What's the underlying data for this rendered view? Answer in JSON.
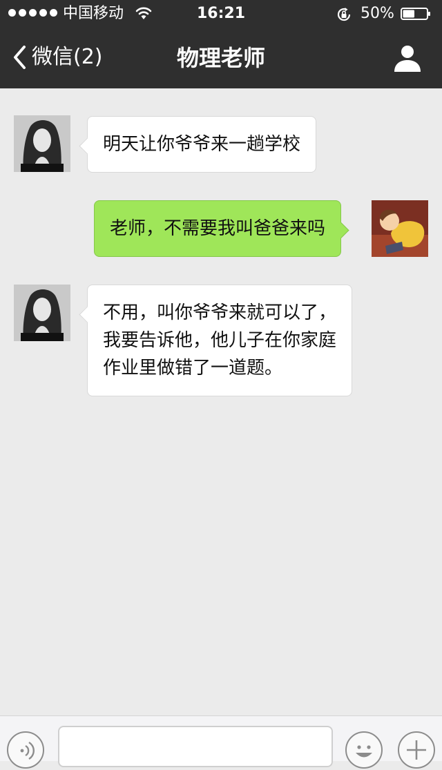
{
  "status_bar": {
    "carrier": "中国移动",
    "time": "16:21",
    "battery_percent": "50%",
    "battery_level": 0.5,
    "signal_strength": 5,
    "icons": [
      "signal-dots-icon",
      "wifi-icon",
      "orientation-lock-icon",
      "battery-icon"
    ]
  },
  "nav": {
    "back_label": "微信(2)",
    "title": "物理老师",
    "right_icon": "contact-profile-icon"
  },
  "messages": [
    {
      "sender": "teacher",
      "direction": "incoming",
      "lines": [
        "明天让你爷爷来一趟学校"
      ]
    },
    {
      "sender": "me",
      "direction": "outgoing",
      "lines": [
        "老师，不需要我叫爸爸来吗"
      ]
    },
    {
      "sender": "teacher",
      "direction": "incoming",
      "lines": [
        "不用，叫你爷爷来就可以了，",
        "我要告诉他，他儿子在你家庭",
        "作业里做错了一道题。"
      ]
    }
  ],
  "input_bar": {
    "voice_icon": "voice-input-icon",
    "emoji_icon": "emoji-icon",
    "add_icon": "plus-icon",
    "text_value": ""
  },
  "colors": {
    "top_bar": "#2f2f2f",
    "chat_background": "#ebebeb",
    "outgoing_bubble": "#9fe659",
    "incoming_bubble": "#ffffff"
  }
}
